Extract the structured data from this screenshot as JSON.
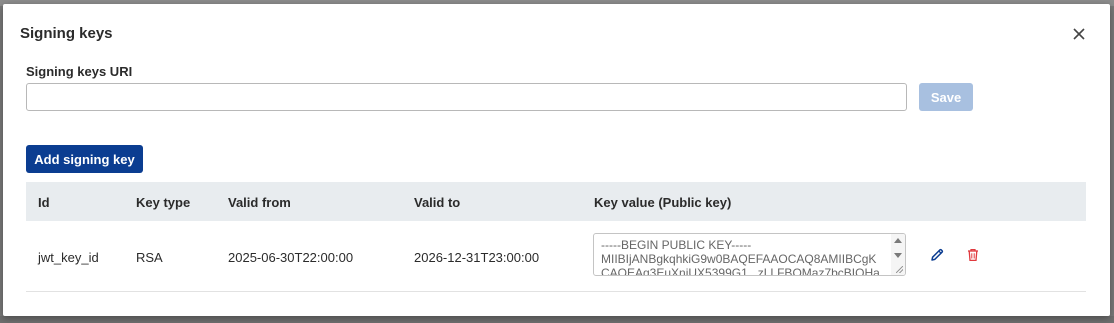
{
  "modal": {
    "title": "Signing keys",
    "close_icon": "close-icon"
  },
  "uri_field": {
    "label": "Signing keys URI",
    "value": "",
    "placeholder": ""
  },
  "buttons": {
    "save_label": "Save",
    "add_label": "Add signing key"
  },
  "table": {
    "headers": [
      "Id",
      "Key type",
      "Valid from",
      "Valid to",
      "Key value (Public key)"
    ],
    "rows": [
      {
        "id": "jwt_key_id",
        "key_type": "RSA",
        "valid_from": "2025-06-30T22:00:00",
        "valid_to": "2026-12-31T23:00:00",
        "key_value": "-----BEGIN PUBLIC KEY-----\nMIIBIjANBgkqhkiG9w0BAQEFAAOCAQ8AMIIBCgK\nCAQEAq3EuXnjUX5399G1...zLLFBOMaz7bcBIQHa"
      }
    ]
  },
  "colors": {
    "primary": "#0b3d91",
    "disabled": "#a8c0e0",
    "delete": "#e0393e",
    "edit": "#0b3d91",
    "header_bg": "#e8ecef"
  },
  "icons": {
    "edit": "pencil-icon",
    "delete": "trash-icon"
  }
}
